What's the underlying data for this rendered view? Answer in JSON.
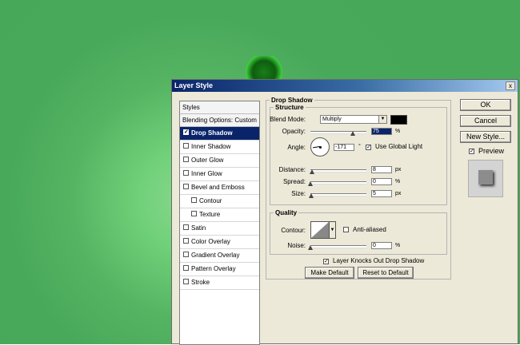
{
  "dialog": {
    "title": "Layer Style",
    "close_glyph": "x"
  },
  "styles_panel": {
    "header": "Styles",
    "blending_options": "Blending Options: Custom",
    "items": [
      {
        "label": "Drop Shadow",
        "checked": true,
        "selected": true,
        "indent": false
      },
      {
        "label": "Inner Shadow",
        "checked": false,
        "selected": false,
        "indent": false
      },
      {
        "label": "Outer Glow",
        "checked": false,
        "selected": false,
        "indent": false
      },
      {
        "label": "Inner Glow",
        "checked": false,
        "selected": false,
        "indent": false
      },
      {
        "label": "Bevel and Emboss",
        "checked": false,
        "selected": false,
        "indent": false
      },
      {
        "label": "Contour",
        "checked": false,
        "selected": false,
        "indent": true
      },
      {
        "label": "Texture",
        "checked": false,
        "selected": false,
        "indent": true
      },
      {
        "label": "Satin",
        "checked": false,
        "selected": false,
        "indent": false
      },
      {
        "label": "Color Overlay",
        "checked": false,
        "selected": false,
        "indent": false
      },
      {
        "label": "Gradient Overlay",
        "checked": false,
        "selected": false,
        "indent": false
      },
      {
        "label": "Pattern Overlay",
        "checked": false,
        "selected": false,
        "indent": false
      },
      {
        "label": "Stroke",
        "checked": false,
        "selected": false,
        "indent": false
      }
    ]
  },
  "drop_shadow": {
    "group_title": "Drop Shadow",
    "structure": {
      "title": "Structure",
      "blend_mode_label": "Blend Mode:",
      "blend_mode_value": "Multiply",
      "shadow_color": "#000000",
      "opacity_label": "Opacity:",
      "opacity_value": "75",
      "opacity_percent": 75,
      "opacity_unit": "%",
      "angle_label": "Angle:",
      "angle_value": "-171",
      "angle_unit": "°",
      "use_global_light_label": "Use Global Light",
      "use_global_light_checked": true,
      "distance_label": "Distance:",
      "distance_value": "8",
      "distance_unit": "px",
      "spread_label": "Spread:",
      "spread_value": "0",
      "spread_unit": "%",
      "size_label": "Size:",
      "size_value": "5",
      "size_unit": "px"
    },
    "quality": {
      "title": "Quality",
      "contour_label": "Contour:",
      "anti_aliased_label": "Anti-aliased",
      "anti_aliased_checked": false,
      "noise_label": "Noise:",
      "noise_value": "0",
      "noise_unit": "%"
    },
    "knock_out_label": "Layer Knocks Out Drop Shadow",
    "knock_out_checked": true,
    "make_default_label": "Make Default",
    "reset_default_label": "Reset to Default"
  },
  "buttons": {
    "ok": "OK",
    "cancel": "Cancel",
    "new_style": "New Style...",
    "preview_label": "Preview",
    "preview_checked": true
  },
  "colors": {
    "canvas_green": "#47a85a",
    "titlebar_start": "#0a246a",
    "titlebar_end": "#a6caf0",
    "dialog_bg": "#ece9d8",
    "selection": "#0a246a"
  }
}
